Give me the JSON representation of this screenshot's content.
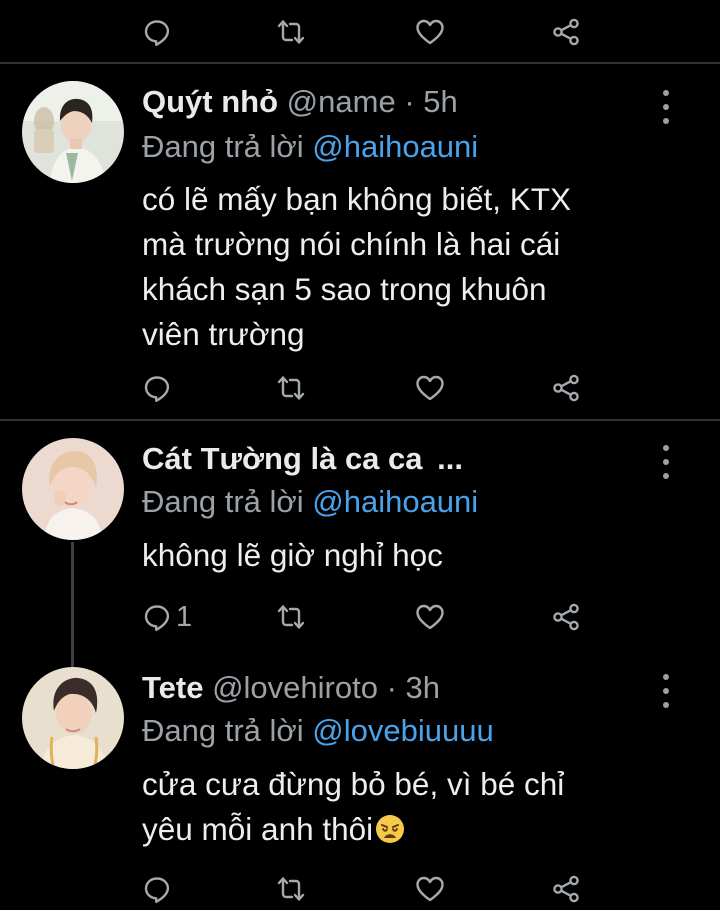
{
  "colors": {
    "background": "#000000",
    "divider": "#2f3336",
    "mention": "#4aa3ea",
    "secondary_text": "#9ca1a6",
    "primary_text": "#eceeef"
  },
  "icons": {
    "reply": "reply-icon",
    "retweet": "retweet-icon",
    "like": "heart-icon",
    "share": "share-icon",
    "more": "more-vertical-icon",
    "emoji": "weary-face-emoji"
  },
  "tweets": [
    {
      "name": "Quýt nhỏ",
      "handle": "@name",
      "dot": "·",
      "time": "5h",
      "replying_prefix": "Đang trả lời",
      "replying_to": "@haihoauni",
      "body_lines": [
        "có lẽ mấy bạn không biết, KTX",
        "mà trường nói chính là hai cái",
        "khách sạn 5 sao trong khuôn",
        "viên trường"
      ],
      "reply_count": ""
    },
    {
      "name": "Cát Tường là ca ca",
      "name_ellipsis": "...",
      "replying_prefix": "Đang trả lời",
      "replying_to": "@haihoauni",
      "body_lines": [
        "không lẽ giờ nghỉ học"
      ],
      "reply_count": "1"
    },
    {
      "name": "Tete",
      "handle": "@lovehiroto",
      "dot": "·",
      "time": "3h",
      "replying_prefix": "Đang trả lời",
      "replying_to": "@lovebiuuuu",
      "body_lines": [
        "cửa cưa đừng bỏ bé, vì bé chỉ",
        "yêu mỗi anh thôi"
      ],
      "reply_count": ""
    }
  ]
}
